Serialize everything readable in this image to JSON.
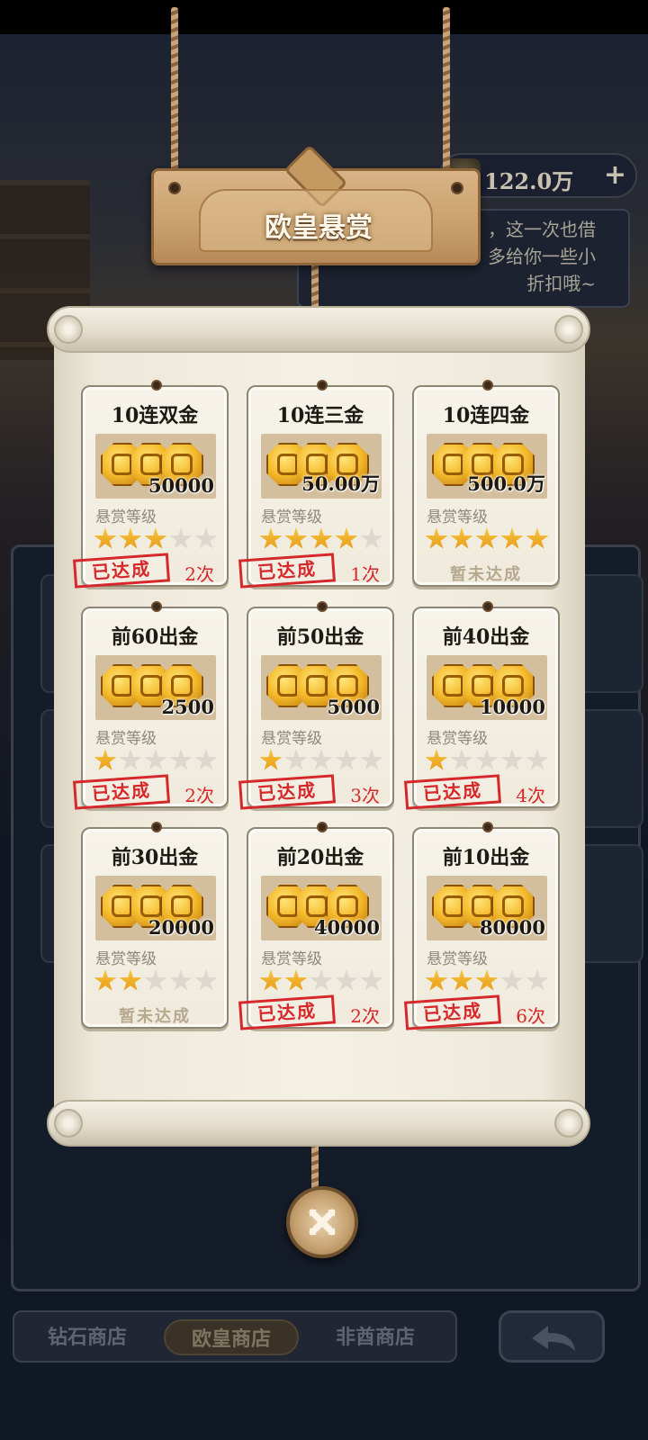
{
  "currency": {
    "value": "122.0万",
    "plus": "+",
    "icon": "coin-icon"
  },
  "npc": {
    "text": "，这一次也借\n多给你一些小\n折扣哦~"
  },
  "dialog": {
    "title": "欧皇悬赏",
    "level_label": "悬赏等级",
    "achieved_label": "已达成",
    "not_achieved_label": "暂未达成",
    "close_icon": "close-icon",
    "cards": [
      {
        "title": "10连双金",
        "reward": "50000",
        "stars": 3,
        "status": "achieved",
        "count": "2次"
      },
      {
        "title": "10连三金",
        "reward": "50.00万",
        "stars": 4,
        "status": "achieved",
        "count": "1次"
      },
      {
        "title": "10连四金",
        "reward": "500.0万",
        "stars": 5,
        "status": "not_achieved",
        "count": ""
      },
      {
        "title": "前60出金",
        "reward": "2500",
        "stars": 1,
        "status": "achieved",
        "count": "2次"
      },
      {
        "title": "前50出金",
        "reward": "5000",
        "stars": 1,
        "status": "achieved",
        "count": "3次"
      },
      {
        "title": "前40出金",
        "reward": "10000",
        "stars": 1,
        "status": "achieved",
        "count": "4次"
      },
      {
        "title": "前30出金",
        "reward": "20000",
        "stars": 2,
        "status": "not_achieved",
        "count": ""
      },
      {
        "title": "前20出金",
        "reward": "40000",
        "stars": 2,
        "status": "achieved",
        "count": "2次"
      },
      {
        "title": "前10出金",
        "reward": "80000",
        "stars": 3,
        "status": "achieved",
        "count": "6次"
      }
    ]
  },
  "tabs": [
    {
      "label": "钻石商店",
      "active": false
    },
    {
      "label": "欧皇商店",
      "active": true
    },
    {
      "label": "非酋商店",
      "active": false
    }
  ],
  "back_icon": "back-arrow-icon",
  "colors": {
    "stamp_red": "#d6272b",
    "star_gold": "#f0ad22",
    "parchment": "#f4f0e4",
    "wood": "#c9a06d"
  }
}
